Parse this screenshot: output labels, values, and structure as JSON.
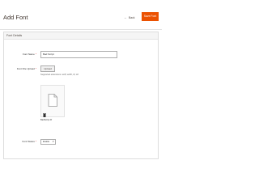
{
  "header": {
    "title": "Add Font",
    "back_label": "Back",
    "back_arrow": "←",
    "save_label": "Save Font"
  },
  "panel": {
    "title": "Font Details"
  },
  "form": {
    "font_name": {
      "label": "Font Name",
      "required": "*",
      "value": "Bad Script"
    },
    "font_file": {
      "label": "Font File Upload",
      "required": "*",
      "button_label": "Upload",
      "note": "Supported extensions: woff, woff2, ttf, otf",
      "file_name": "BadScript.ttf",
      "file_icon": "document-icon",
      "remove_icon": "trash-icon"
    },
    "font_status": {
      "label": "Font Status",
      "required": "*",
      "selected": "Enable",
      "chevron": "▾"
    }
  },
  "colors": {
    "accent": "#eb5202",
    "label_text": "#303030",
    "border": "#adadad"
  }
}
